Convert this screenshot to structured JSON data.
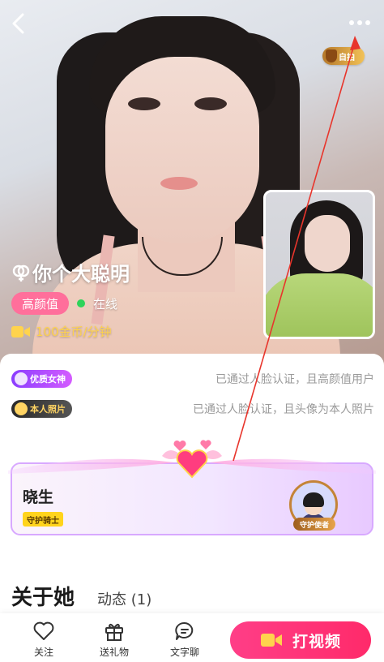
{
  "profile": {
    "name": "你个大聪明",
    "tag": "高颜值",
    "status": "在线",
    "price": "100金币/分钟",
    "rank_badge": "自拍"
  },
  "verifications": [
    {
      "badge": "优质女神",
      "desc": "已通过人脸认证，且高颜值用户"
    },
    {
      "badge": "本人照片",
      "desc": "已通过人脸认证，且头像为本人照片"
    }
  ],
  "guardian": {
    "name": "晓生",
    "title": "守护骑士",
    "role": "守护使者"
  },
  "tabs": {
    "about": "关于她",
    "moments": "动态 (1)"
  },
  "bottom_bar": {
    "follow": "关注",
    "gift": "送礼物",
    "chat": "文字聊",
    "video_call": "打视频"
  },
  "colors": {
    "accent_pink": "#ff3e87",
    "tag_pink": "#ff6f9b",
    "online_green": "#2ed35a",
    "price_gold": "#ffd34d",
    "annotation_arrow": "#e8352c"
  }
}
